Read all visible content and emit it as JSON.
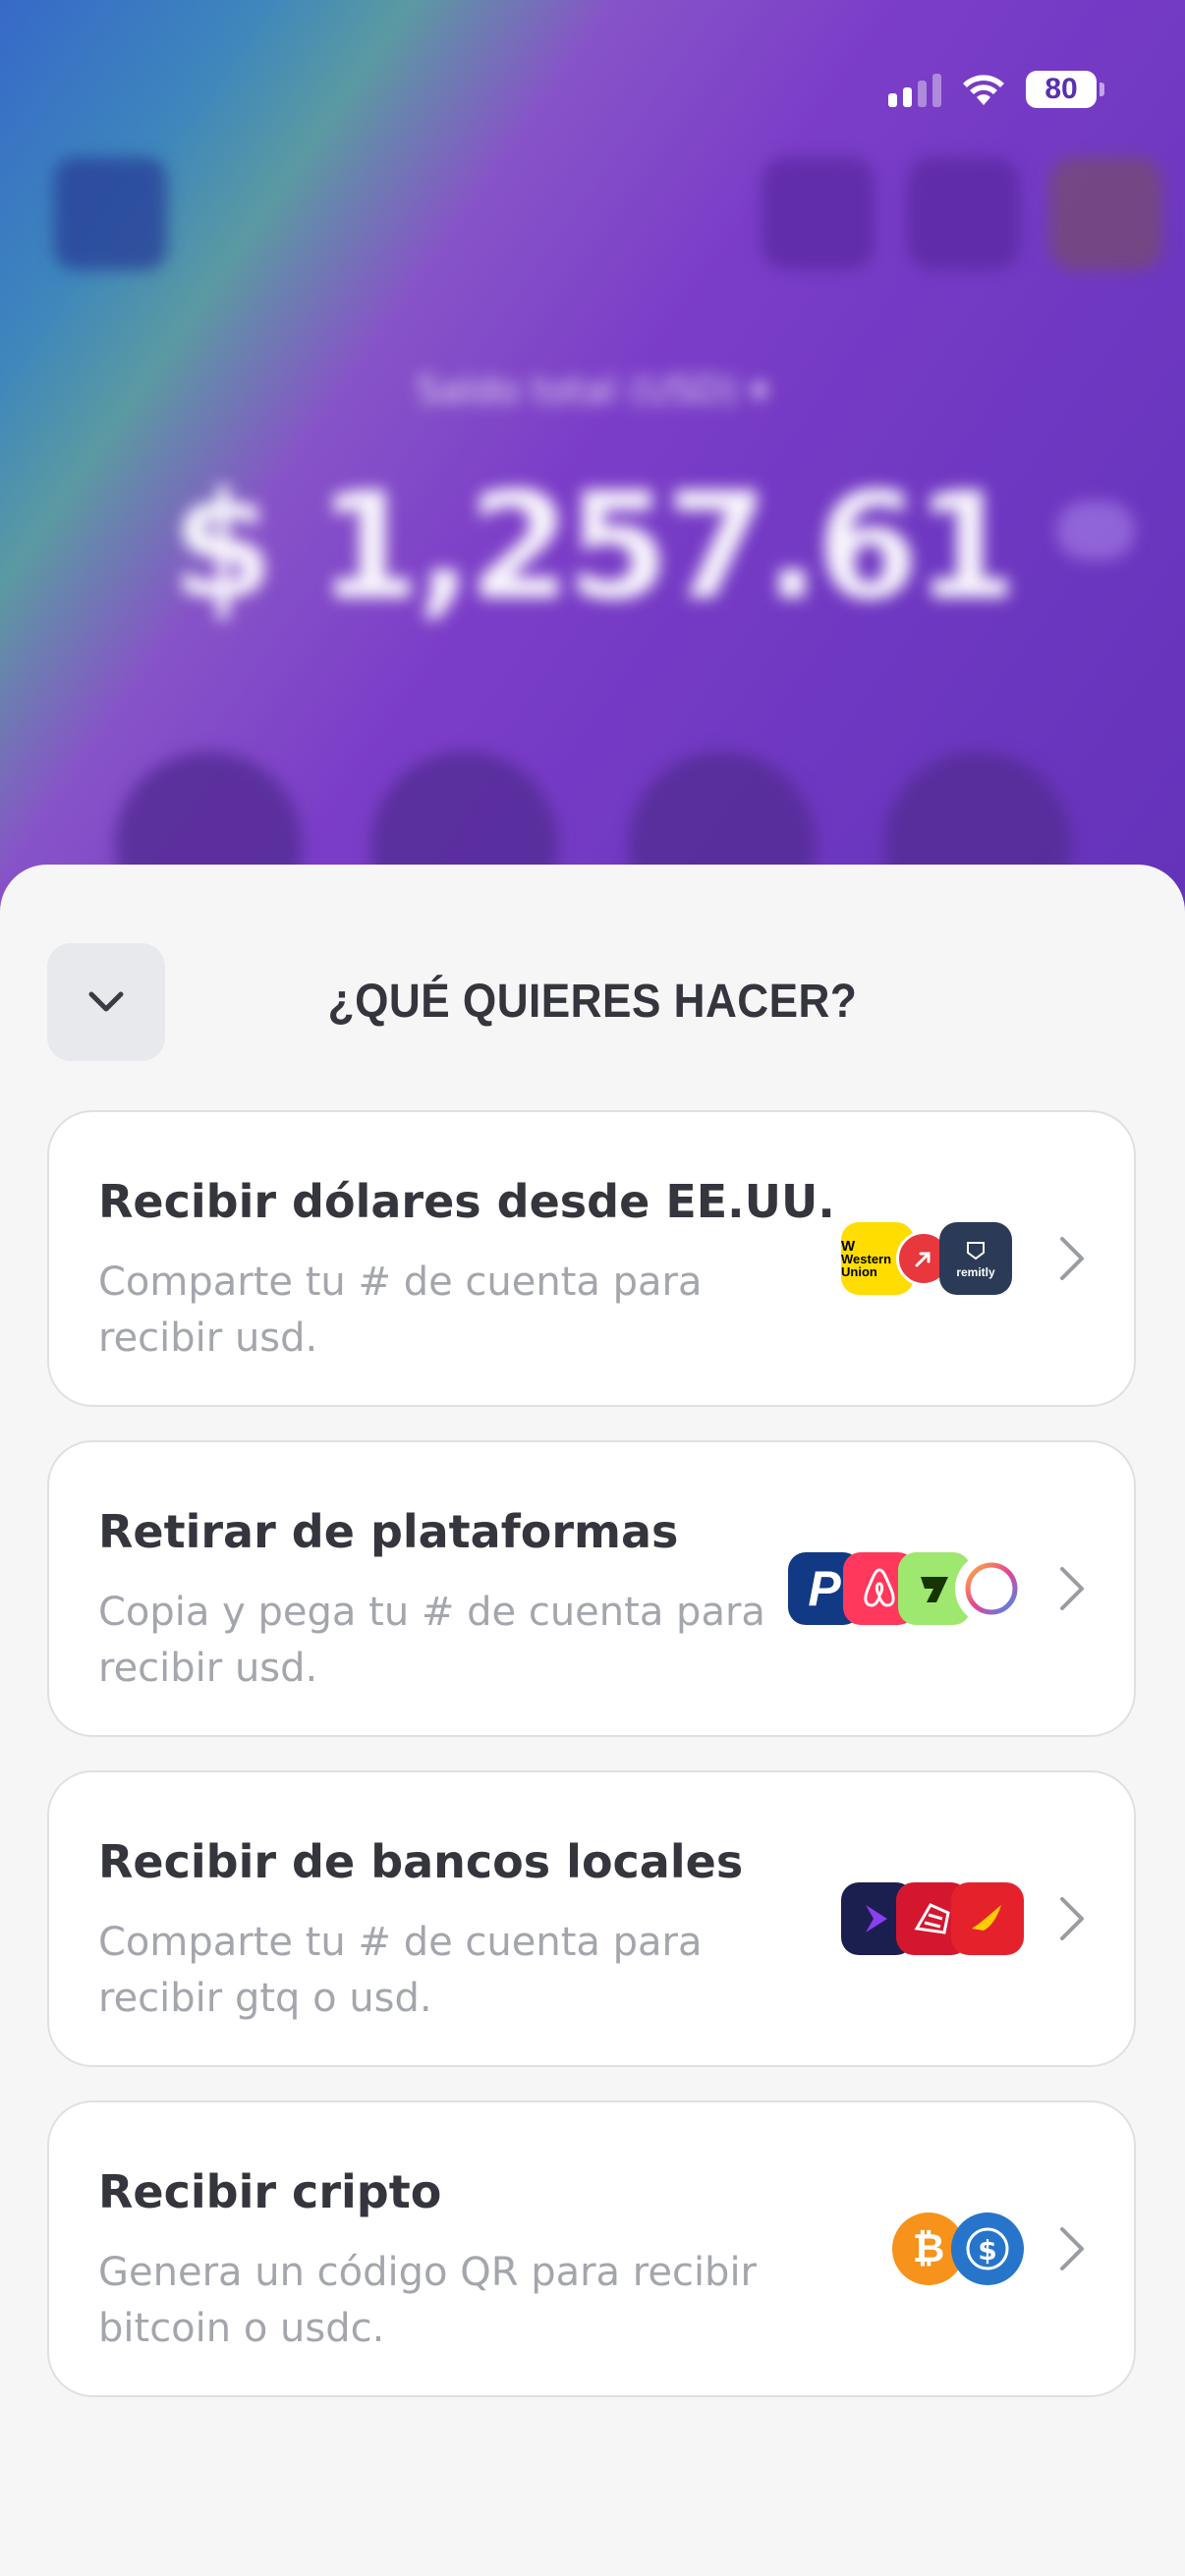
{
  "status_bar": {
    "battery": "80"
  },
  "background": {
    "balance_label": "Saldo total (USD) ▾",
    "balance_amount": "$ 1,257.61"
  },
  "sheet": {
    "title": "¿QUÉ QUIERES HACER?",
    "options": [
      {
        "title": "Recibir dólares desde EE.UU.",
        "description": "Comparte tu # de cuenta para recibir usd.",
        "logos": [
          "western-union",
          "remesa-red",
          "remitly"
        ],
        "logo_text": {
          "western_union": "Western Union",
          "remitly": "remitly"
        }
      },
      {
        "title": "Retirar de plataformas",
        "description": "Copia y pega tu # de cuenta para recibir usd.",
        "logos": [
          "paypal",
          "airbnb",
          "wise",
          "ring-app"
        ]
      },
      {
        "title": "Recibir de bancos locales",
        "description": "Comparte tu # de cuenta para recibir gtq o usd.",
        "logos": [
          "bank-purple",
          "bank-red-1",
          "bank-red-2"
        ]
      },
      {
        "title": "Recibir cripto",
        "description": "Genera un código QR para recibir bitcoin o usdc.",
        "logos": [
          "bitcoin",
          "usdc"
        ]
      }
    ]
  },
  "colors": {
    "sheet_bg": "#f6f6f7",
    "title_text": "#34353d",
    "desc_text": "#a4a6ad",
    "card_border": "#dfe0e4"
  }
}
